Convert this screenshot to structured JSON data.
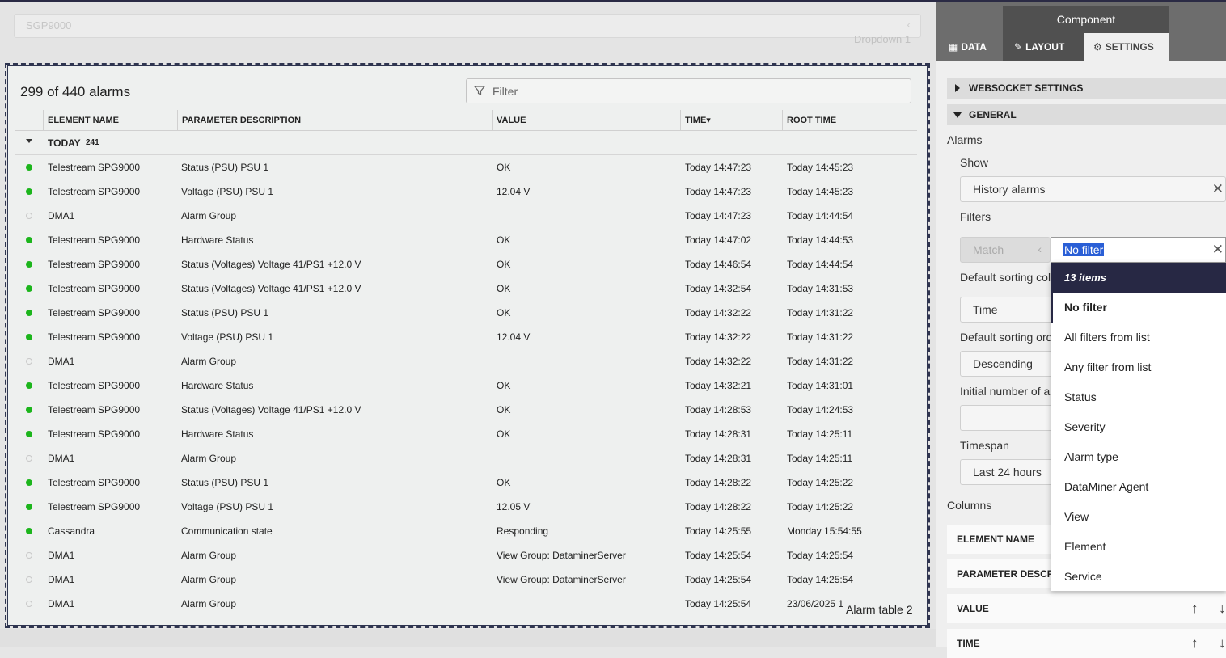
{
  "dropdown": {
    "value": "SGP9000",
    "caption": "Dropdown 1"
  },
  "alarm_table": {
    "count_label": "299 of 440 alarms",
    "filter_placeholder": "Filter",
    "caption": "Alarm table 2",
    "columns": [
      "ELEMENT NAME",
      "PARAMETER DESCRIPTION",
      "VALUE",
      "TIME",
      "ROOT TIME"
    ],
    "sort_indicator": "▾",
    "group": {
      "label": "TODAY",
      "count": "241"
    },
    "rows": [
      {
        "active": true,
        "element": "Telestream SPG9000",
        "param": "Status (PSU) PSU 1",
        "value": "OK",
        "time": "Today 14:47:23",
        "root": "Today 14:45:23"
      },
      {
        "active": true,
        "element": "Telestream SPG9000",
        "param": "Voltage (PSU) PSU 1",
        "value": "12.04 V",
        "time": "Today 14:47:23",
        "root": "Today 14:45:23"
      },
      {
        "active": false,
        "element": "DMA1",
        "param": "Alarm Group",
        "value": "",
        "time": "Today 14:47:23",
        "root": "Today 14:44:54"
      },
      {
        "active": true,
        "element": "Telestream SPG9000",
        "param": "Hardware Status",
        "value": "OK",
        "time": "Today 14:47:02",
        "root": "Today 14:44:53"
      },
      {
        "active": true,
        "element": "Telestream SPG9000",
        "param": "Status (Voltages) Voltage 41/PS1 +12.0 V",
        "value": "OK",
        "time": "Today 14:46:54",
        "root": "Today 14:44:54"
      },
      {
        "active": true,
        "element": "Telestream SPG9000",
        "param": "Status (Voltages) Voltage 41/PS1 +12.0 V",
        "value": "OK",
        "time": "Today 14:32:54",
        "root": "Today 14:31:53"
      },
      {
        "active": true,
        "element": "Telestream SPG9000",
        "param": "Status (PSU) PSU 1",
        "value": "OK",
        "time": "Today 14:32:22",
        "root": "Today 14:31:22"
      },
      {
        "active": true,
        "element": "Telestream SPG9000",
        "param": "Voltage (PSU) PSU 1",
        "value": "12.04 V",
        "time": "Today 14:32:22",
        "root": "Today 14:31:22"
      },
      {
        "active": false,
        "element": "DMA1",
        "param": "Alarm Group",
        "value": "",
        "time": "Today 14:32:22",
        "root": "Today 14:31:22"
      },
      {
        "active": true,
        "element": "Telestream SPG9000",
        "param": "Hardware Status",
        "value": "OK",
        "time": "Today 14:32:21",
        "root": "Today 14:31:01"
      },
      {
        "active": true,
        "element": "Telestream SPG9000",
        "param": "Status (Voltages) Voltage 41/PS1 +12.0 V",
        "value": "OK",
        "time": "Today 14:28:53",
        "root": "Today 14:24:53"
      },
      {
        "active": true,
        "element": "Telestream SPG9000",
        "param": "Hardware Status",
        "value": "OK",
        "time": "Today 14:28:31",
        "root": "Today 14:25:11"
      },
      {
        "active": false,
        "element": "DMA1",
        "param": "Alarm Group",
        "value": "",
        "time": "Today 14:28:31",
        "root": "Today 14:25:11"
      },
      {
        "active": true,
        "element": "Telestream SPG9000",
        "param": "Status (PSU) PSU 1",
        "value": "OK",
        "time": "Today 14:28:22",
        "root": "Today 14:25:22"
      },
      {
        "active": true,
        "element": "Telestream SPG9000",
        "param": "Voltage (PSU) PSU 1",
        "value": "12.05 V",
        "time": "Today 14:28:22",
        "root": "Today 14:25:22"
      },
      {
        "active": true,
        "element": "Cassandra",
        "param": "Communication state",
        "value": "Responding",
        "time": "Today 14:25:55",
        "root": "Monday 15:54:55"
      },
      {
        "active": false,
        "element": "DMA1",
        "param": "Alarm Group",
        "value": "View Group: DataminerServer",
        "time": "Today 14:25:54",
        "root": "Today 14:25:54"
      },
      {
        "active": false,
        "element": "DMA1",
        "param": "Alarm Group",
        "value": "View Group: DataminerServer",
        "time": "Today 14:25:54",
        "root": "Today 14:25:54"
      },
      {
        "active": false,
        "element": "DMA1",
        "param": "Alarm Group",
        "value": "",
        "time": "Today 14:25:54",
        "root": "23/06/2025 1"
      }
    ]
  },
  "panel": {
    "component_title": "Component",
    "tabs": {
      "data": "DATA",
      "layout": "LAYOUT",
      "settings": "SETTINGS"
    },
    "websocket_section": "WEBSOCKET SETTINGS",
    "general_section": "GENERAL",
    "alarms_label": "Alarms",
    "show_label": "Show",
    "show_value": "History alarms",
    "filters_label": "Filters",
    "match_value": "Match",
    "filter_value": "No filter",
    "sorting_col_label": "Default sorting col",
    "sorting_col_value": "Time",
    "sorting_order_label": "Default sorting ord",
    "sorting_order_value": "Descending",
    "initial_number_label": "Initial number of a",
    "initial_number_value": "",
    "timespan_label": "Timespan",
    "timespan_value": "Last 24 hours",
    "columns_label": "Columns",
    "column_items": [
      "ELEMENT NAME",
      "PARAMETER DESCRI",
      "VALUE",
      "TIME"
    ],
    "filter_menu": {
      "header": "13 items",
      "items": [
        "No filter",
        "All filters from list",
        "Any filter from list",
        "Status",
        "Severity",
        "Alarm type",
        "DataMiner Agent",
        "View",
        "Element",
        "Service"
      ]
    }
  },
  "colors": {
    "accent": "#272844",
    "active_dot": "#1cb51c",
    "selection": "#2a5fd6"
  }
}
